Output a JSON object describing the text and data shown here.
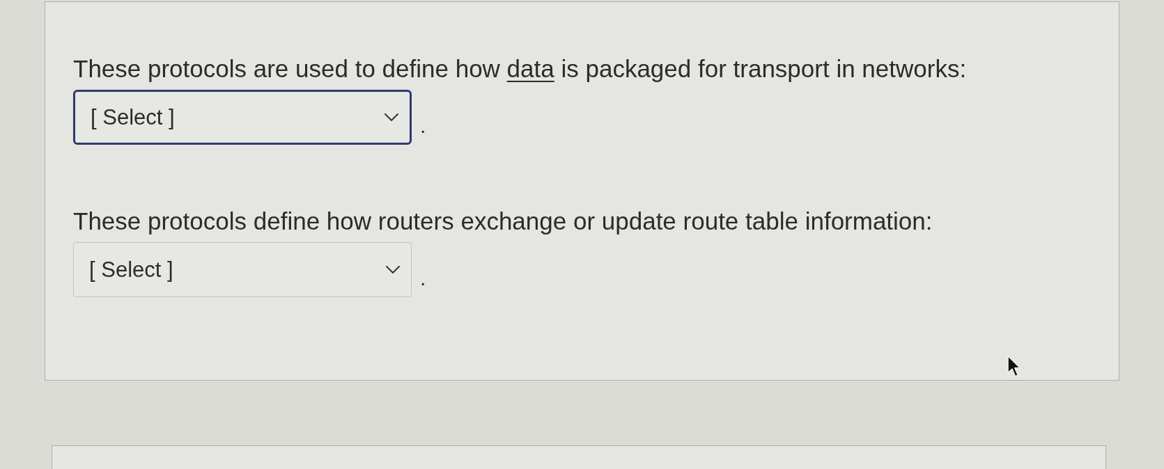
{
  "questions": [
    {
      "prompt": [
        {
          "text": "These protocols are used to define how ",
          "underlined": false
        },
        {
          "text": "data",
          "underlined": true
        },
        {
          "text": " is packaged for transport in networks:",
          "underlined": false
        }
      ],
      "dropdown": {
        "value": "[ Select ]",
        "focused": true
      },
      "trailing": "."
    },
    {
      "prompt": [
        {
          "text": "These protocols define how routers exchange or update route table information:",
          "underlined": false
        }
      ],
      "dropdown": {
        "value": "[ Select ]",
        "focused": false
      },
      "trailing": "."
    }
  ]
}
